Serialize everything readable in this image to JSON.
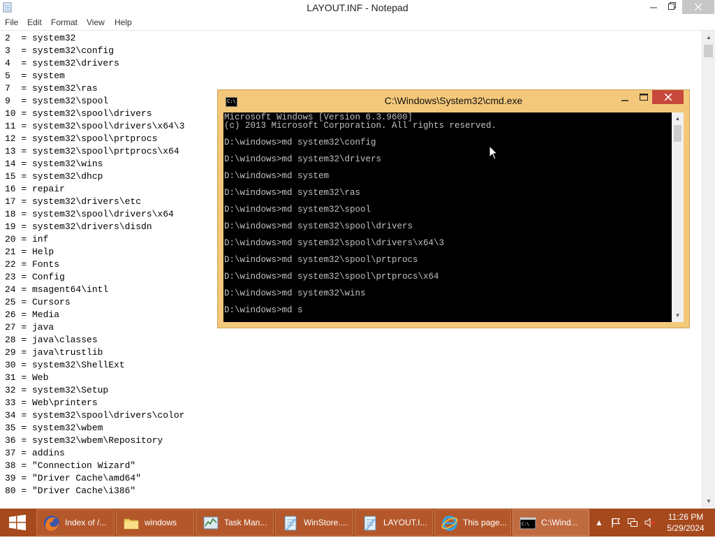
{
  "notepad": {
    "title": "LAYOUT.INF - Notepad",
    "menu": [
      "File",
      "Edit",
      "Format",
      "View",
      "Help"
    ],
    "lines": [
      "2  = system32",
      "3  = system32\\config",
      "4  = system32\\drivers",
      "5  = system",
      "7  = system32\\ras",
      "9  = system32\\spool",
      "10 = system32\\spool\\drivers",
      "11 = system32\\spool\\drivers\\x64\\3",
      "12 = system32\\spool\\prtprocs",
      "13 = system32\\spool\\prtprocs\\x64",
      "14 = system32\\wins",
      "15 = system32\\dhcp",
      "16 = repair",
      "17 = system32\\drivers\\etc",
      "18 = system32\\spool\\drivers\\x64",
      "19 = system32\\drivers\\disdn",
      "20 = inf",
      "21 = Help",
      "22 = Fonts",
      "23 = Config",
      "24 = msagent64\\intl",
      "25 = Cursors",
      "26 = Media",
      "27 = java",
      "28 = java\\classes",
      "29 = java\\trustlib",
      "30 = system32\\ShellExt",
      "31 = Web",
      "32 = system32\\Setup",
      "33 = Web\\printers",
      "34 = system32\\spool\\drivers\\color",
      "35 = system32\\wbem",
      "36 = system32\\wbem\\Repository",
      "37 = addins",
      "38 = \"Connection Wizard\"",
      "39 = \"Driver Cache\\amd64\"",
      "80 = \"Driver Cache\\i386\""
    ]
  },
  "cmd": {
    "title": "C:\\Windows\\System32\\cmd.exe",
    "icon_glyph": "C:\\",
    "lines": [
      "Microsoft Windows [Version 6.3.9600]",
      "(c) 2013 Microsoft Corporation. All rights reserved.",
      "",
      "D:\\windows>md system32\\config",
      "",
      "D:\\windows>md system32\\drivers",
      "",
      "D:\\windows>md system",
      "",
      "D:\\windows>md system32\\ras",
      "",
      "D:\\windows>md system32\\spool",
      "",
      "D:\\windows>md system32\\spool\\drivers",
      "",
      "D:\\windows>md system32\\spool\\drivers\\x64\\3",
      "",
      "D:\\windows>md system32\\spool\\prtprocs",
      "",
      "D:\\windows>md system32\\spool\\prtprocs\\x64",
      "",
      "D:\\windows>md system32\\wins",
      "",
      "D:\\windows>md s"
    ]
  },
  "taskbar": {
    "items": [
      {
        "label": "Index of /...",
        "icon": "firefox-icon"
      },
      {
        "label": "windows",
        "icon": "folder-icon"
      },
      {
        "label": "Task Man...",
        "icon": "task-manager-icon"
      },
      {
        "label": "WinStore....",
        "icon": "notepad-icon"
      },
      {
        "label": "LAYOUT.I...",
        "icon": "notepad-icon"
      },
      {
        "label": "This page...",
        "icon": "internet-explorer-icon"
      },
      {
        "label": "C:\\Wind...",
        "icon": "cmd-icon"
      }
    ],
    "active_index": 6,
    "clock_time": "11:26 PM",
    "clock_date": "5/29/2024"
  },
  "colors": {
    "taskbar": "#a6491d",
    "cmd_frame": "#f4c87a",
    "cmd_close": "#c7483c",
    "console_bg": "#000000",
    "console_text": "#c0c0c0"
  }
}
